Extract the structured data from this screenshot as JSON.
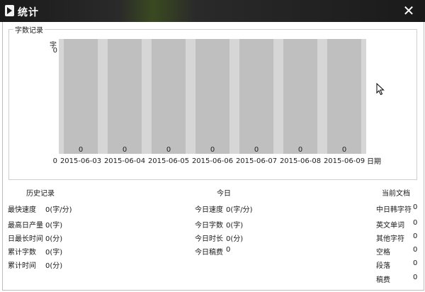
{
  "window": {
    "title": "统计",
    "close_icon": "✕"
  },
  "record_group": {
    "title": "字数记录"
  },
  "chart_data": {
    "type": "bar",
    "title": "",
    "ylabel": "字",
    "xlabel": "日期",
    "y_tick_top": "0",
    "y_tick_bottom": "0",
    "ylim": [
      0,
      0
    ],
    "categories": [
      "2015-06-03",
      "2015-06-04",
      "2015-06-05",
      "2015-06-06",
      "2015-06-07",
      "2015-06-08",
      "2015-06-09"
    ],
    "values": [
      0,
      0,
      0,
      0,
      0,
      0,
      0
    ],
    "data_labels": [
      "0",
      "0",
      "0",
      "0",
      "0",
      "0",
      "0"
    ],
    "bar_color": "#bfbfbf",
    "bg_color": "#d6d6d6",
    "grid": false
  },
  "history": {
    "title": "历史记录",
    "fastest_speed": {
      "label": "最快速度",
      "value": "0(字/分)"
    },
    "max_daily_output": {
      "label": "最高日产量",
      "value": "0(字)"
    },
    "max_daily_time": {
      "label": "日最长时间",
      "value": "0(分)"
    },
    "total_words": {
      "label": "累计字数",
      "value": "0(字)"
    },
    "total_time": {
      "label": "累计时间",
      "value": "0(分)"
    }
  },
  "today": {
    "title": "今日",
    "speed": {
      "label": "今日速度",
      "value": "0(字/分)"
    },
    "words": {
      "label": "今日字数",
      "value": "0(字)"
    },
    "duration": {
      "label": "今日时长",
      "value": "0(分)"
    },
    "fee": {
      "label": "今日稿费",
      "value": "0"
    }
  },
  "current_doc": {
    "title": "当前文档",
    "cjk_chars": {
      "label": "中日韩字符",
      "value": "0"
    },
    "english_words": {
      "label": "英文单词",
      "value": "0"
    },
    "other_chars": {
      "label": "其他字符",
      "value": "0"
    },
    "spaces": {
      "label": "空格",
      "value": "0"
    },
    "paragraphs": {
      "label": "段落",
      "value": "0"
    },
    "fee": {
      "label": "稿费",
      "value": "0"
    }
  }
}
